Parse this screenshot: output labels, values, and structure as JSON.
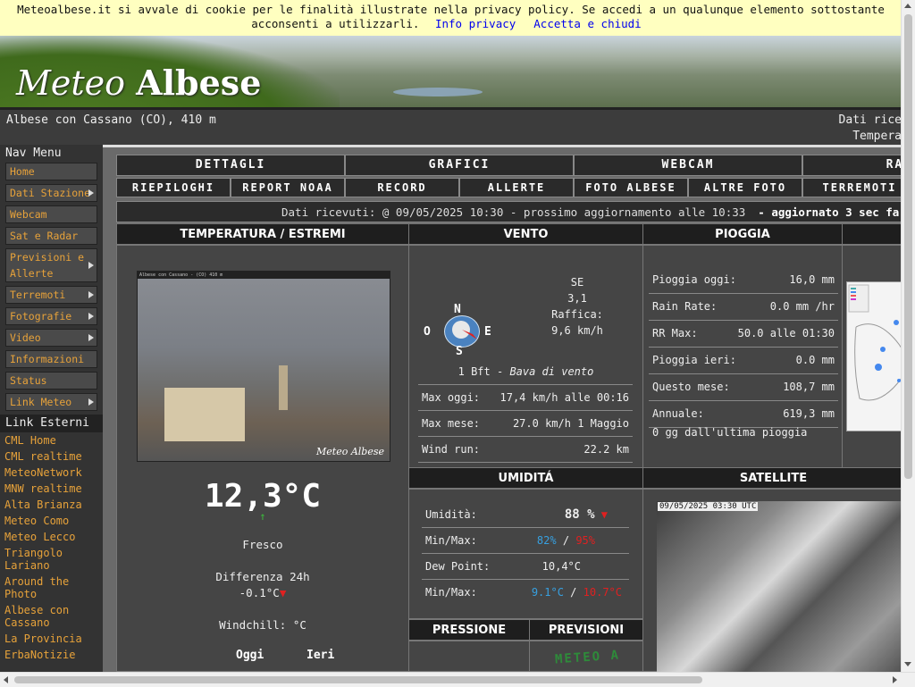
{
  "cookie": {
    "text": "Meteoalbese.it si avvale di cookie per le finalità illustrate nella privacy policy. Se accedi a un qualunque elemento sottostante acconsenti a utilizzarli.",
    "privacy_link": "Info privacy",
    "accept_link": "Accetta e chiudi"
  },
  "banner": {
    "title_light": "Meteo",
    "title_bold": "Albese"
  },
  "location": {
    "place": "Albese con Cassano (CO), 410 m",
    "right_line1": "Dati rice",
    "right_line2": "Tempera"
  },
  "sidebar": {
    "nav_title": "Nav Menu",
    "items": [
      {
        "label": "Home",
        "submenu": false
      },
      {
        "label": "Dati Stazione",
        "submenu": true
      },
      {
        "label": "Webcam",
        "submenu": false
      },
      {
        "label": "Sat e Radar",
        "submenu": false
      },
      {
        "label": "Previsioni e Allerte",
        "submenu": true
      },
      {
        "label": "Terremoti",
        "submenu": true
      },
      {
        "label": "Fotografie",
        "submenu": true
      },
      {
        "label": "Video",
        "submenu": true
      },
      {
        "label": "Informazioni",
        "submenu": false
      },
      {
        "label": "Status",
        "submenu": false
      },
      {
        "label": "Link Meteo",
        "submenu": true
      }
    ],
    "external_title": "Link Esterni",
    "external": [
      "CML Home",
      "CML realtime",
      "MeteoNetwork",
      "MNW realtime",
      "Alta Brianza",
      "Meteo Como",
      "Meteo Lecco",
      "Triangolo Lariano",
      "Around the Photo",
      "Albese con Cassano",
      "La Provincia",
      "ErbaNotizie"
    ]
  },
  "menu": {
    "row1": [
      "DETTAGLI",
      "GRAFICI",
      "WEBCAM",
      "RADAR/S"
    ],
    "row2": [
      "RIEPILOGHI",
      "REPORT NOAA",
      "RECORD",
      "ALLERTE",
      "FOTO ALBESE",
      "ALTRE FOTO",
      "TERREMOTI"
    ]
  },
  "update": {
    "text": "Dati ricevuti: @ 09/05/2025 10:30 - prossimo aggiornamento alle 10:33",
    "ago": "- aggiornato 3 sec fa"
  },
  "temperature": {
    "title": "TEMPERATURA / ESTREMI",
    "webcam_watermark": "Meteo Albese",
    "webcam_caption": "Albese con Cassano - (CO) 410 m",
    "value": "12,3°C",
    "trend_arrow": "↑",
    "condition": "Fresco",
    "diff_label": "Differenza 24h",
    "diff_value": "-0.1°C",
    "diff_arrow": "▼",
    "windchill": "Windchill: °C",
    "today": "Oggi",
    "yesterday": "Ieri"
  },
  "wind": {
    "title": "VENTO",
    "direction": "SE",
    "speed": "3,1",
    "gust_label": "Raffica:",
    "gust": "9,6 km/h",
    "compass": {
      "n": "N",
      "s": "S",
      "e": "E",
      "o": "O"
    },
    "bft": "1 Bft",
    "bft_desc": "Bava di vento",
    "rows": [
      {
        "label": "Max oggi:",
        "value": "17,4 km/h alle 00:16"
      },
      {
        "label": "Max mese:",
        "value": "27.0 km/h 1 Maggio"
      },
      {
        "label": "Wind run:",
        "value": "22.2 km"
      }
    ]
  },
  "rain": {
    "title": "PIOGGIA",
    "rows": [
      {
        "label": "Pioggia oggi:",
        "value": "16,0 mm"
      },
      {
        "label": "Rain Rate:",
        "value": "0.0 mm /hr"
      },
      {
        "label": "RR Max:",
        "value": "50.0 alle 01:30"
      },
      {
        "label": "Pioggia ieri:",
        "value": "0.0 mm"
      },
      {
        "label": "Questo mese:",
        "value": "108,7 mm"
      },
      {
        "label": "Annuale:",
        "value": "619,3 mm"
      }
    ],
    "since": "0 gg dall'ultima pioggia"
  },
  "humidity": {
    "title": "UMIDITÁ",
    "label": "Umidità:",
    "value": "88 %",
    "arrow": "▼",
    "minmax_label": "Min/Max:",
    "min": "82%",
    "max": "95%",
    "dew_label": "Dew Point:",
    "dew": "10,4°C",
    "dew_minmax_label": "Min/Max:",
    "dew_min": "9.1°C",
    "dew_max": "10.7°C",
    "sep": "/"
  },
  "satellite": {
    "title": "SATELLITE",
    "timestamp": "09/05/2025 03:30 UTC"
  },
  "pressure": {
    "title": "PRESSIONE"
  },
  "forecast": {
    "title": "PREVISIONI",
    "logo_text": "METEO A"
  },
  "colors": {
    "accent": "#e7a23a",
    "cookie_bg": "#ffffc0",
    "panel": "#454545",
    "red": "#e02020",
    "blue": "#37a0e0"
  }
}
